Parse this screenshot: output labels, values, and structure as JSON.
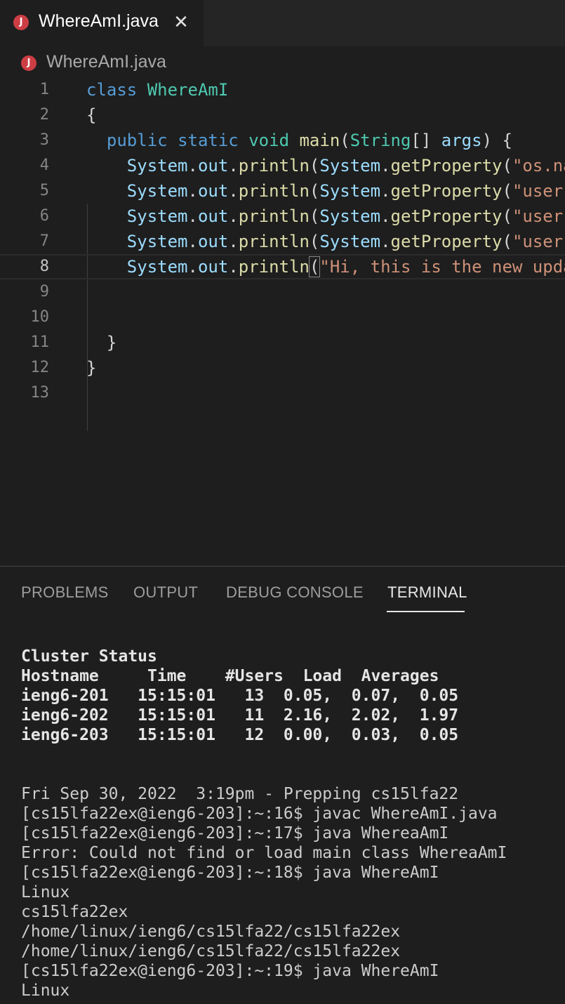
{
  "tab": {
    "icon_letter": "J",
    "title": "WhereAmI.java",
    "close_glyph": "✕"
  },
  "breadcrumb": {
    "icon_letter": "J",
    "file": "WhereAmI.java"
  },
  "editor": {
    "current_line": 8,
    "lines": [
      {
        "n": "1",
        "tokens": [
          {
            "t": "class",
            "c": "kw"
          },
          {
            "t": " "
          },
          {
            "t": "WhereAmI",
            "c": "ty"
          }
        ]
      },
      {
        "n": "2",
        "tokens": [
          {
            "t": "{"
          }
        ]
      },
      {
        "n": "3",
        "tokens": [
          {
            "t": "  "
          },
          {
            "t": "public",
            "c": "kw"
          },
          {
            "t": " "
          },
          {
            "t": "static",
            "c": "kw"
          },
          {
            "t": " "
          },
          {
            "t": "void",
            "c": "ty"
          },
          {
            "t": " "
          },
          {
            "t": "main",
            "c": "fn"
          },
          {
            "t": "("
          },
          {
            "t": "String",
            "c": "ty"
          },
          {
            "t": "[] "
          },
          {
            "t": "args",
            "c": "vr"
          },
          {
            "t": ") {"
          }
        ]
      },
      {
        "n": "4",
        "tokens": [
          {
            "t": "    "
          },
          {
            "t": "System",
            "c": "vr"
          },
          {
            "t": "."
          },
          {
            "t": "out",
            "c": "vr"
          },
          {
            "t": "."
          },
          {
            "t": "println",
            "c": "fn"
          },
          {
            "t": "("
          },
          {
            "t": "System",
            "c": "vr"
          },
          {
            "t": "."
          },
          {
            "t": "getProperty",
            "c": "fn"
          },
          {
            "t": "("
          },
          {
            "t": "\"os.na",
            "c": "st"
          }
        ]
      },
      {
        "n": "5",
        "tokens": [
          {
            "t": "    "
          },
          {
            "t": "System",
            "c": "vr"
          },
          {
            "t": "."
          },
          {
            "t": "out",
            "c": "vr"
          },
          {
            "t": "."
          },
          {
            "t": "println",
            "c": "fn"
          },
          {
            "t": "("
          },
          {
            "t": "System",
            "c": "vr"
          },
          {
            "t": "."
          },
          {
            "t": "getProperty",
            "c": "fn"
          },
          {
            "t": "("
          },
          {
            "t": "\"user",
            "c": "st"
          }
        ]
      },
      {
        "n": "6",
        "tokens": [
          {
            "t": "    "
          },
          {
            "t": "System",
            "c": "vr"
          },
          {
            "t": "."
          },
          {
            "t": "out",
            "c": "vr"
          },
          {
            "t": "."
          },
          {
            "t": "println",
            "c": "fn"
          },
          {
            "t": "("
          },
          {
            "t": "System",
            "c": "vr"
          },
          {
            "t": "."
          },
          {
            "t": "getProperty",
            "c": "fn"
          },
          {
            "t": "("
          },
          {
            "t": "\"user",
            "c": "st"
          }
        ]
      },
      {
        "n": "7",
        "tokens": [
          {
            "t": "    "
          },
          {
            "t": "System",
            "c": "vr"
          },
          {
            "t": "."
          },
          {
            "t": "out",
            "c": "vr"
          },
          {
            "t": "."
          },
          {
            "t": "println",
            "c": "fn"
          },
          {
            "t": "("
          },
          {
            "t": "System",
            "c": "vr"
          },
          {
            "t": "."
          },
          {
            "t": "getProperty",
            "c": "fn"
          },
          {
            "t": "("
          },
          {
            "t": "\"user",
            "c": "st"
          }
        ]
      },
      {
        "n": "8",
        "tokens": [
          {
            "t": "    "
          },
          {
            "t": "System",
            "c": "vr"
          },
          {
            "t": "."
          },
          {
            "t": "out",
            "c": "vr"
          },
          {
            "t": "."
          },
          {
            "t": "println",
            "c": "fn"
          },
          {
            "t": "(",
            "c": "bm"
          },
          {
            "t": "\"Hi, this is the new upda",
            "c": "st"
          }
        ]
      },
      {
        "n": "9",
        "tokens": []
      },
      {
        "n": "10",
        "tokens": []
      },
      {
        "n": "11",
        "tokens": [
          {
            "t": "  }"
          }
        ]
      },
      {
        "n": "12",
        "tokens": [
          {
            "t": "}"
          }
        ]
      },
      {
        "n": "13",
        "tokens": []
      }
    ]
  },
  "panel": {
    "tabs": [
      {
        "label": "PROBLEMS",
        "active": false
      },
      {
        "label": "OUTPUT",
        "active": false
      },
      {
        "label": "DEBUG CONSOLE",
        "active": false
      },
      {
        "label": "TERMINAL",
        "active": true
      }
    ],
    "terminal_lines": [
      {
        "text": "Cluster Status",
        "bold": true
      },
      {
        "text": "Hostname     Time    #Users  Load  Averages",
        "bold": true
      },
      {
        "text": "ieng6-201   15:15:01   13  0.05,  0.07,  0.05",
        "bold": true
      },
      {
        "text": "ieng6-202   15:15:01   11  2.16,  2.02,  1.97",
        "bold": true
      },
      {
        "text": "ieng6-203   15:15:01   12  0.00,  0.03,  0.05",
        "bold": true
      },
      {
        "text": ""
      },
      {
        "text": ""
      },
      {
        "text": "Fri Sep 30, 2022  3:19pm - Prepping cs15lfa22"
      },
      {
        "text": "[cs15lfa22ex@ieng6-203]:~:16$ javac WhereAmI.java"
      },
      {
        "text": "[cs15lfa22ex@ieng6-203]:~:17$ java WhereaAmI"
      },
      {
        "text": "Error: Could not find or load main class WhereaAmI"
      },
      {
        "text": "[cs15lfa22ex@ieng6-203]:~:18$ java WhereAmI"
      },
      {
        "text": "Linux"
      },
      {
        "text": "cs15lfa22ex"
      },
      {
        "text": "/home/linux/ieng6/cs15lfa22/cs15lfa22ex"
      },
      {
        "text": "/home/linux/ieng6/cs15lfa22/cs15lfa22ex"
      },
      {
        "text": "[cs15lfa22ex@ieng6-203]:~:19$ java WhereAmI"
      },
      {
        "text": "Linux"
      }
    ]
  }
}
